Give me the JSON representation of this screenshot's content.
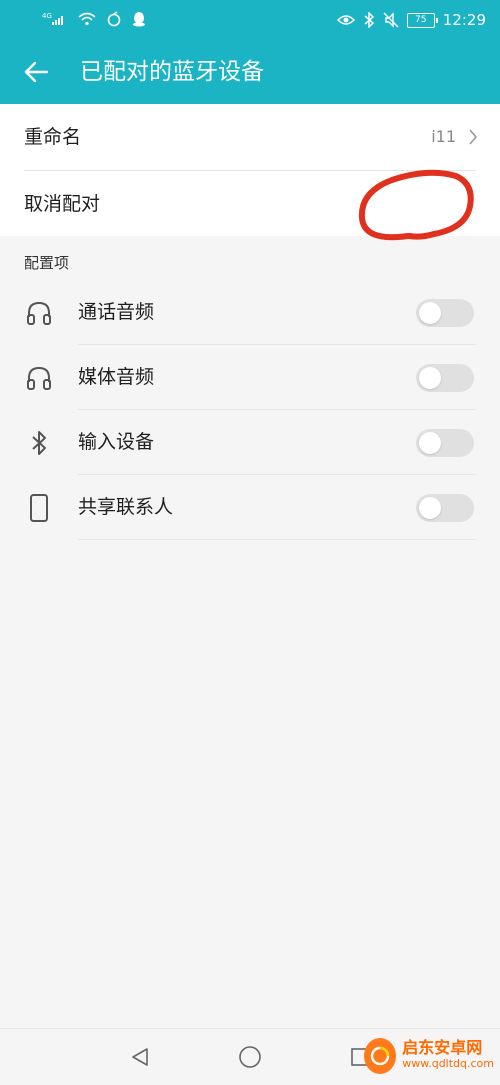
{
  "status_bar": {
    "network_label": "4G",
    "battery": "75",
    "time": "12:29"
  },
  "app_bar": {
    "title": "已配对的蓝牙设备"
  },
  "device_settings": {
    "rename_label": "重命名",
    "rename_value": "i11",
    "unpair_label": "取消配对"
  },
  "profiles": {
    "section_title": "配置项",
    "items": [
      {
        "label": "通话音频",
        "icon": "headphones-icon",
        "enabled": false
      },
      {
        "label": "媒体音频",
        "icon": "headphones-icon",
        "enabled": false
      },
      {
        "label": "输入设备",
        "icon": "bluetooth-icon",
        "enabled": false
      },
      {
        "label": "共享联系人",
        "icon": "phone-icon",
        "enabled": false
      }
    ]
  },
  "watermark": {
    "title": "启东安卓网",
    "url": "www.qdltdq.com"
  },
  "colors": {
    "accent": "#1bb4c4",
    "toggle_off": "#e0e0e0",
    "marker": "#e0301e",
    "watermark": "#ff6a00"
  }
}
